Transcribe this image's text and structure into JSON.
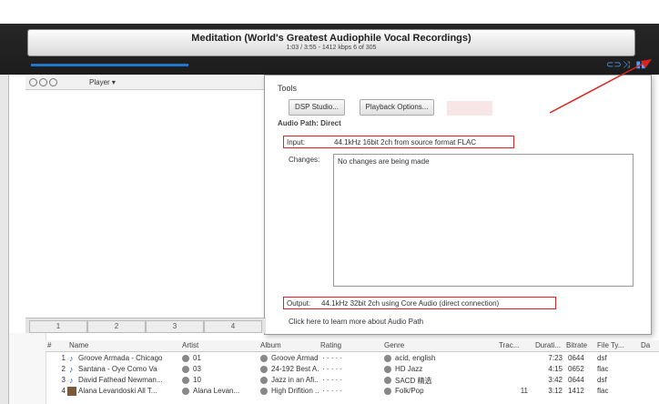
{
  "nowplaying": {
    "title": "Meditation (World's Greatest Audiophile Vocal Recordings)",
    "subline": "1:03 / 3:55 - 1412 kbps   6 of 305",
    "progress_fraction": 0.26
  },
  "toolbar": {
    "player_menu": "Player ▾"
  },
  "popup": {
    "title": "Tools",
    "dsp_button": "DSP Studio...",
    "playback_button": "Playback Options...",
    "audio_path_title": "Audio Path: Direct",
    "input_label": "Input:",
    "input_value": "44.1kHz 16bit 2ch from source format FLAC",
    "changes_label": "Changes:",
    "changes_value": "No changes are being made",
    "output_label": "Output:",
    "output_value": "44.1kHz 32bit 2ch using Core Audio (direct connection)",
    "learn_more": "Click here to learn more about Audio Path"
  },
  "tabs": [
    "1",
    "2",
    "3",
    "4"
  ],
  "table": {
    "headers": [
      "#",
      "Name",
      "Artist",
      "Album",
      "Rating",
      "Genre",
      "Trac...",
      "Durati...",
      "Bitrate",
      "File Ty...",
      "Da"
    ],
    "rows": [
      {
        "num": "1",
        "name": "Groove Armada - Chicago",
        "artist": "01",
        "album": "Groove Armad...",
        "rating": "· · · · ·",
        "genre": "acid, english",
        "track": "",
        "duration": "7:23",
        "bitrate": "0644",
        "filetype": "dsf"
      },
      {
        "num": "2",
        "name": "Santana - Oye Como Va",
        "artist": "03",
        "album": "24-192 Best A...",
        "rating": "· · · · ·",
        "genre": "HD Jazz",
        "track": "",
        "duration": "4:15",
        "bitrate": "0652",
        "filetype": "flac"
      },
      {
        "num": "3",
        "name": "David Fathead Newman...",
        "artist": "10",
        "album": "Jazz in an Afi...",
        "rating": "· · · · ·",
        "genre": "SACD 精选",
        "track": "",
        "duration": "3:42",
        "bitrate": "0644",
        "filetype": "dsf"
      },
      {
        "num": "4",
        "name": "Alana Levandoski All T...",
        "artist": "Alana Levan...",
        "album": "High Drifition ...",
        "rating": "· · · · ·",
        "genre": "Folk/Pop",
        "track": "11",
        "duration": "3:12",
        "bitrate": "1412",
        "filetype": "flac"
      }
    ]
  },
  "colors": {
    "accent": "#1f78c7",
    "highlight": "#d22222"
  }
}
